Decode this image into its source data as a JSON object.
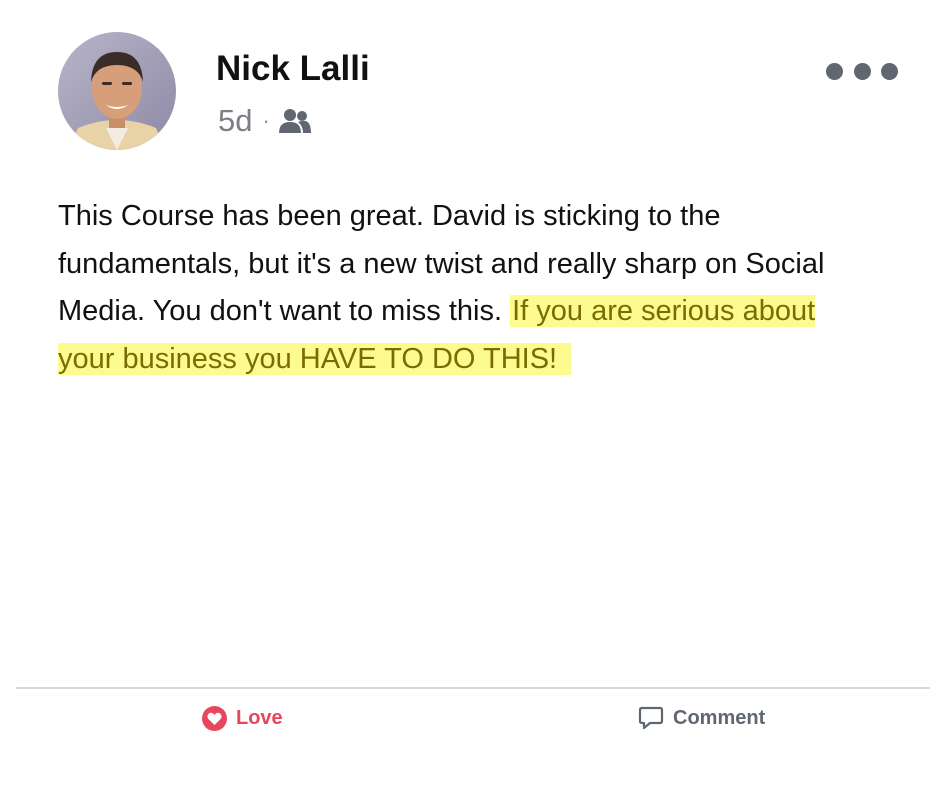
{
  "post": {
    "author": "Nick Lalli",
    "time": "5d",
    "separator": "·",
    "audience_icon": "friends-icon",
    "more_icon": "more-options-icon",
    "body_plain": "This Course has been great. David is sticking to the fundamentals, but it's a new twist and really sharp on Social Media. You don't want to miss this. ",
    "body_highlighted": "If you are serious about your business you HAVE TO DO THIS!",
    "highlight_color": "#fdfb8f"
  },
  "actions": {
    "love_label": "Love",
    "love_icon": "heart-icon",
    "love_color": "#e8455e",
    "comment_label": "Comment",
    "comment_icon": "comment-bubble-icon",
    "comment_color": "#606770"
  }
}
